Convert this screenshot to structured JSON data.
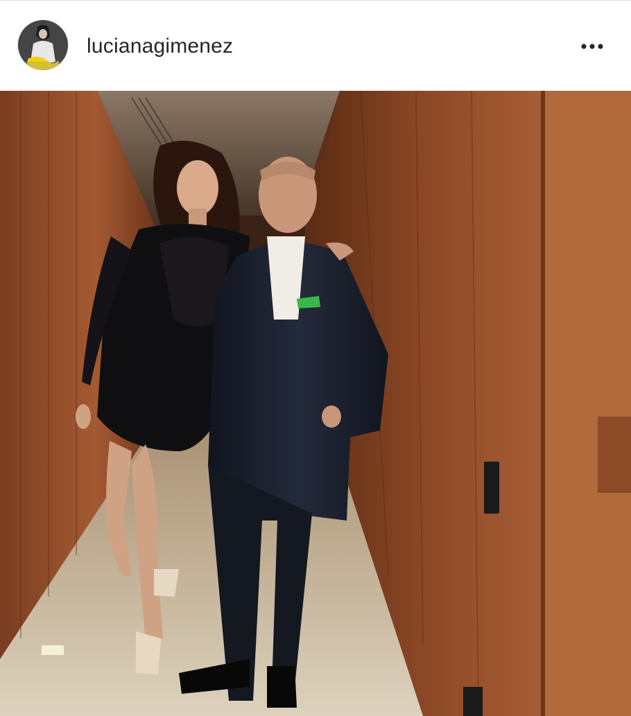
{
  "post": {
    "username": "lucianagimenez",
    "more_icon": "more-horizontal-icon",
    "avatar_icon": "profile-avatar"
  },
  "colors": {
    "header_bg": "#ffffff",
    "username_text": "#262626",
    "wood_panel": "#8a4a2a",
    "floor": "#cfc2aa"
  }
}
